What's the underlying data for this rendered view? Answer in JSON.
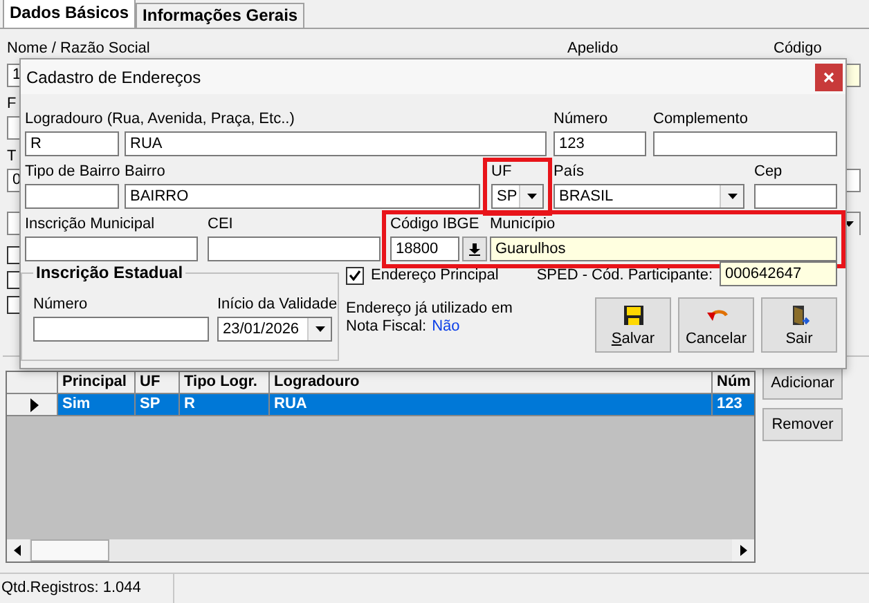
{
  "tabs": [
    {
      "label": "Dados Básicos",
      "selected": true
    },
    {
      "label": "Informações Gerais",
      "selected": false
    }
  ],
  "background_form": {
    "labels": [
      "Nome / Razão Social",
      "Apelido",
      "Código"
    ],
    "name_value": "1",
    "label_f": "F",
    "label_t": "T",
    "value_t": "0"
  },
  "dialog": {
    "title": "Cadastro de Endereços",
    "rows": [
      {
        "fields": [
          {
            "label": "Logradouro (Rua, Avenida, Praça, Etc..)",
            "kind": "text",
            "value": "R",
            "flagged": false,
            "required": false
          },
          {
            "kind": "text",
            "value": "RUA",
            "flagged": false,
            "required": false
          },
          {
            "label": "Número",
            "kind": "text",
            "value": "123",
            "flagged": false,
            "required": false
          },
          {
            "label": "Complemento",
            "kind": "text",
            "flagged": false,
            "required": false
          }
        ]
      },
      {
        "fields": [
          {
            "label": "Tipo de Bairro",
            "kind": "text",
            "flagged": false,
            "required": false
          },
          {
            "label": "Bairro",
            "kind": "text",
            "value": "BAIRRO",
            "flagged": false,
            "required": false
          },
          {
            "label": "UF",
            "kind": "combo",
            "value": "SP",
            "flagged": true,
            "required": false
          },
          {
            "label": "País",
            "kind": "combo",
            "value": "BRASIL",
            "flagged": false,
            "required": false
          },
          {
            "label": "Cep",
            "kind": "text",
            "flagged": false,
            "required": false
          }
        ]
      },
      {
        "fields": [
          {
            "label": "Inscrição Municipal",
            "kind": "text",
            "flagged": false,
            "required": false
          },
          {
            "label": "CEI",
            "kind": "text",
            "flagged": false,
            "required": false
          },
          {
            "label": "Código IBGE",
            "kind": "lookup",
            "value": "18800",
            "flagged": true,
            "required": false
          },
          {
            "label": "Município",
            "kind": "text",
            "value": "Guarulhos",
            "flagged": true,
            "required": true
          }
        ]
      }
    ],
    "inscricao_estadual": {
      "title": "Inscrição Estadual",
      "numero_label": "Número",
      "inicio_label": "Início da Validade",
      "inicio_value": "23/01/2026"
    },
    "principal": {
      "label": "Endereço Principal",
      "checked": true
    },
    "sped": {
      "label": "SPED - Cód. Participante:",
      "value": "000642647"
    },
    "note": {
      "line_1": "Endereço já utilizado em",
      "line_2": "Nota Fiscal:",
      "value": "Não"
    },
    "buttons": [
      {
        "label": "Salvar",
        "kind": "save",
        "underline_first": true
      },
      {
        "label": "Cancelar",
        "kind": "undo",
        "underline_first": false
      },
      {
        "label": "Sair",
        "kind": "exit",
        "underline_first": false
      }
    ]
  },
  "grid": {
    "columns": [
      "Principal",
      "UF",
      "Tipo Logr.",
      "Logradouro",
      "Núm"
    ],
    "rows": [
      {
        "selected": true,
        "cells": [
          "Sim",
          "SP",
          "R",
          "RUA",
          "123"
        ]
      }
    ]
  },
  "side_buttons": [
    "Adicionar",
    "Remover"
  ],
  "status_bar": [
    "Qtd.Registros: 1.044"
  ]
}
